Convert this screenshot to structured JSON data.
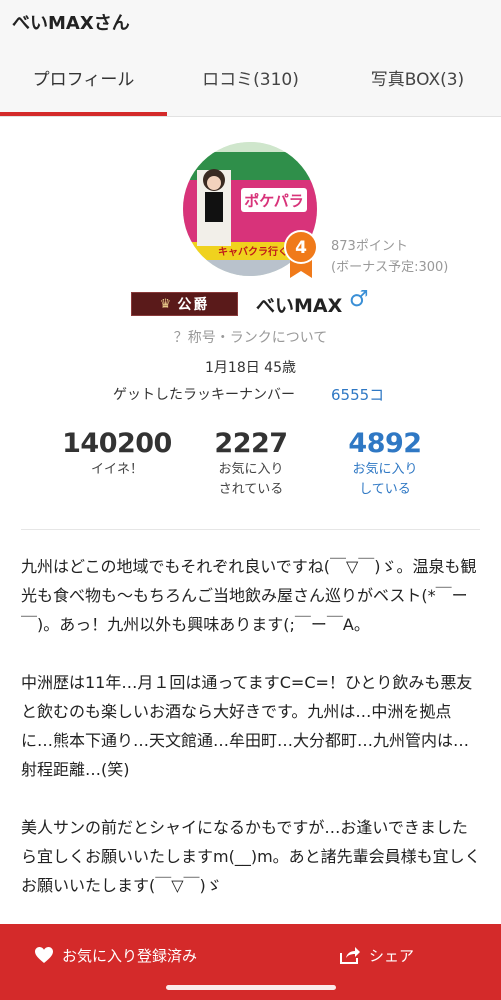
{
  "header": {
    "title": "べいMAXさん"
  },
  "tabs": [
    {
      "label": "プロフィール",
      "active": true
    },
    {
      "label": "ロコミ(310)",
      "active": false
    },
    {
      "label": "写真BOX(3)",
      "active": false
    }
  ],
  "profile": {
    "avatar_sign_text": "ポケパラ",
    "avatar_banner_text": "キャバクラ行くなら",
    "rank_number": "4",
    "points": "873ポイント",
    "bonus_points": "(ボーナス予定:300)",
    "title_badge": "公爵",
    "username": "べいMAX",
    "gender_icon": "♂",
    "rank_link": "？称号・ランクについて",
    "birth_age": "1月18日 45歳",
    "lucky_label": "ゲットしたラッキーナンバー",
    "lucky_value": "6555コ"
  },
  "stats": [
    {
      "value": "140200",
      "label_1": "イイネ！",
      "label_2": ""
    },
    {
      "value": "2227",
      "label_1": "お気に入り",
      "label_2": "されている"
    },
    {
      "value": "4892",
      "label_1": "お気に入り",
      "label_2": "している"
    }
  ],
  "bio": [
    "九州はどこの地域でもそれぞれ良いですね(￣▽￣)ゞ。温泉も観光も食べ物も〜もちろんご当地飲み屋さん巡りがベスト(*￣ー￣)。あっ！九州以外も興味あります(;￣ー￣A。",
    "中洲歴は11年…月１回は通ってますC=C=！ひとり飲みも悪友と飲むのも楽しいお酒なら大好きです。九州は…中洲を拠点に…熊本下通り…天文館通…牟田町…大分都町…九州管内は…射程距離…(笑)",
    "美人サンの前だとシャイになるかもですが…お逢いできましたら宜しくお願いいたしますm(__)m。あと諸先輩会員様も宜しくお願いいたします(￣▽￣)ゞ"
  ],
  "bottom_bar": {
    "favorite_label": "お気に入り登録済み",
    "share_label": "シェア"
  },
  "colors": {
    "accent": "#d42a2a",
    "link": "#2f78c4",
    "rank_badge": "#f07a1a"
  }
}
